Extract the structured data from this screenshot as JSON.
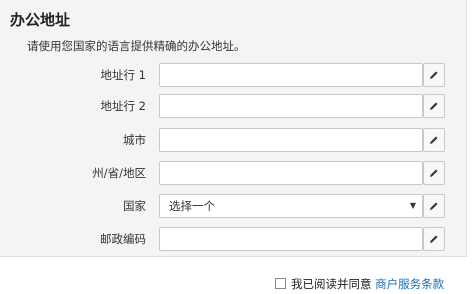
{
  "section": {
    "title": "办公地址",
    "description": "请使用您国家的语言提供精确的办公地址。"
  },
  "form": {
    "address1": {
      "label": "地址行 1",
      "value": ""
    },
    "address2": {
      "label": "地址行 2",
      "value": ""
    },
    "city": {
      "label": "城市",
      "value": ""
    },
    "state": {
      "label": "州/省/地区",
      "value": ""
    },
    "country": {
      "label": "国家",
      "selected": "选择一个"
    },
    "postal": {
      "label": "邮政编码",
      "value": ""
    }
  },
  "edit_icon": "pencil-icon",
  "agreement": {
    "text": "我已阅读并同意",
    "link": "商户服务条款",
    "checked": false
  },
  "colors": {
    "panel_bg": "#f4f4f4",
    "link": "#1a6fb4"
  }
}
